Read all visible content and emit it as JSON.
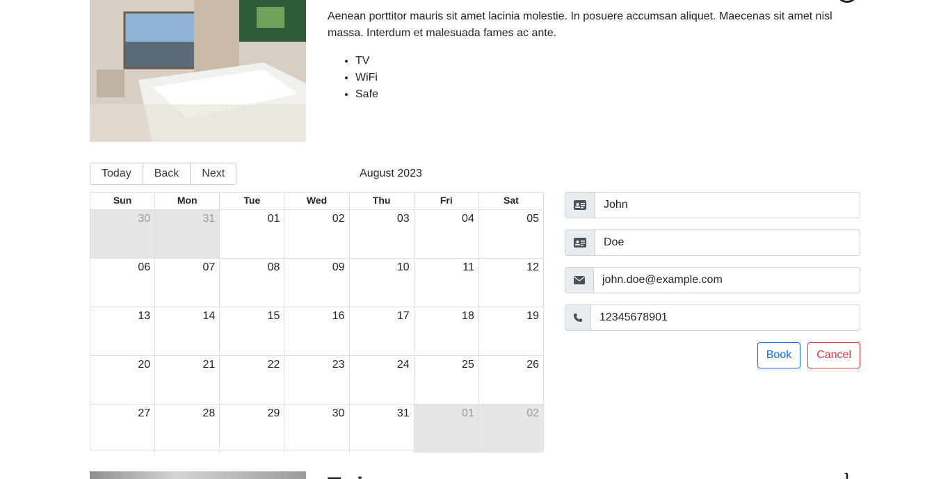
{
  "room": {
    "description": "Aenean porttitor mauris sit amet lacinia molestie. In posuere accumsan aliquet. Maecenas sit amet nisl massa. Interdum et malesuada fames ac ante.",
    "amenities": [
      "TV",
      "WiFi",
      "Safe"
    ]
  },
  "calendar": {
    "buttons": {
      "today": "Today",
      "back": "Back",
      "next": "Next"
    },
    "month_label": "August 2023",
    "weekdays": [
      "Sun",
      "Mon",
      "Tue",
      "Wed",
      "Thu",
      "Fri",
      "Sat"
    ],
    "weeks": [
      [
        {
          "d": "30",
          "off": true
        },
        {
          "d": "31",
          "off": true
        },
        {
          "d": "01"
        },
        {
          "d": "02"
        },
        {
          "d": "03"
        },
        {
          "d": "04"
        },
        {
          "d": "05"
        }
      ],
      [
        {
          "d": "06"
        },
        {
          "d": "07"
        },
        {
          "d": "08"
        },
        {
          "d": "09"
        },
        {
          "d": "10"
        },
        {
          "d": "11"
        },
        {
          "d": "12"
        }
      ],
      [
        {
          "d": "13"
        },
        {
          "d": "14"
        },
        {
          "d": "15"
        },
        {
          "d": "16"
        },
        {
          "d": "17"
        },
        {
          "d": "18"
        },
        {
          "d": "19"
        }
      ],
      [
        {
          "d": "20"
        },
        {
          "d": "21"
        },
        {
          "d": "22"
        },
        {
          "d": "23"
        },
        {
          "d": "24"
        },
        {
          "d": "25"
        },
        {
          "d": "26"
        }
      ],
      [
        {
          "d": "27"
        },
        {
          "d": "28"
        },
        {
          "d": "29"
        },
        {
          "d": "30"
        },
        {
          "d": "31"
        },
        {
          "d": "01",
          "off": true
        },
        {
          "d": "02",
          "off": true
        }
      ]
    ]
  },
  "form": {
    "firstname": {
      "value": "John",
      "icon": "id-card-icon"
    },
    "lastname": {
      "value": "Doe",
      "icon": "id-card-icon"
    },
    "email": {
      "value": "john.doe@example.com",
      "icon": "envelope-icon"
    },
    "phone": {
      "value": "12345678901",
      "icon": "phone-icon"
    },
    "book_label": "Book",
    "cancel_label": "Cancel"
  },
  "next_room": {
    "title": "Twin"
  },
  "colors": {
    "primary": "#0d6efd",
    "danger": "#dc3545",
    "off_day_bg": "#e6e6e6",
    "addon_bg": "#e9ecef"
  }
}
